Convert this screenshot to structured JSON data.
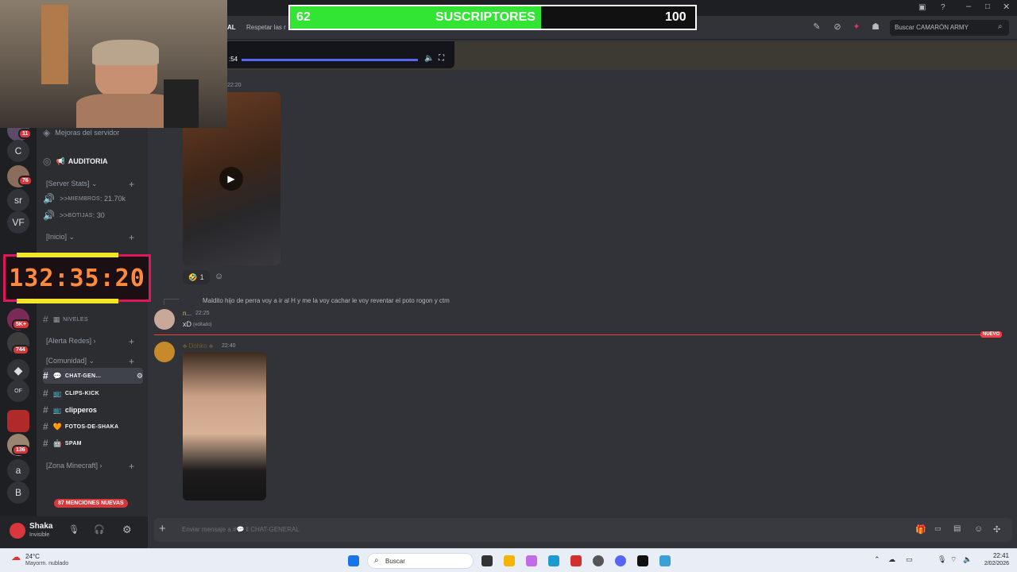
{
  "subscribers": {
    "current": "62",
    "label": "SUSCRIPTORES",
    "goal": "100",
    "progress": 0.62,
    "fill_color": "#33e533"
  },
  "timer": {
    "value": "132:35:20",
    "color": "#ff8a3d"
  },
  "topbar": {
    "channel_label": "AL",
    "topic": "Respetar las r",
    "search_placeholder": "Buscar CAMARÓN ARMY"
  },
  "video_player": {
    "time": ":54"
  },
  "rail": {
    "items": [
      {
        "label": "",
        "badge": "11"
      },
      {
        "label": "C",
        "badge": ""
      },
      {
        "label": "",
        "badge": "76"
      },
      {
        "label": "sr",
        "badge": ""
      },
      {
        "label": "VF",
        "badge": ""
      },
      {
        "label": "",
        "badge": "5K+"
      },
      {
        "label": "",
        "badge": "744"
      },
      {
        "label": "",
        "badge": ""
      },
      {
        "label": "OF",
        "badge": ""
      },
      {
        "label": "",
        "badge": ""
      },
      {
        "label": "",
        "badge": "136"
      },
      {
        "label": "a",
        "badge": ""
      },
      {
        "label": "B",
        "badge": ""
      }
    ]
  },
  "sidebar": {
    "boost": "Mejoras del servidor",
    "auditoria": "AUDITORIA",
    "server_stats": "[Server Stats]",
    "miembros_label": "MIEMBROS",
    "miembros_value": "21.70k",
    "botijas_label": "BOTIJAS",
    "botijas_value": "30",
    "inicio": "[Inicio]",
    "niveles": "NIVELES",
    "alerta_redes": "[Alerta Redes]",
    "comunidad": "[Comunidad]",
    "channels": [
      {
        "name": "CHAT-GEN...",
        "active": true
      },
      {
        "name": "CLIPS-KICK",
        "active": false
      },
      {
        "name": "clipperos",
        "active": false
      },
      {
        "name": "FOTOS-DE-SHAKA",
        "active": false
      },
      {
        "name": "SPAM",
        "active": false
      }
    ],
    "zona_minecraft": "[Zona Minecraft]",
    "menciones": "87 MENCIONES NUEVAS"
  },
  "user": {
    "name": "Shaka",
    "status": "Invisible"
  },
  "messages": {
    "ts1": "22:20",
    "reaction_count": "1",
    "reply_text": "Maldito hijo de perra voy a ir al H y me la voy cachar le voy reventar el poto rogon y ctm",
    "reply_author": "n...",
    "reply_ts": "22:25",
    "reply_body": "xD",
    "edited": "(editado)",
    "new_label": "NUEVO",
    "author3": "♣ Dohko ♣",
    "ts3": "22:40"
  },
  "composer": {
    "placeholder": "Enviar mensaje a #💬 ‖ CHAT-GENERAL"
  },
  "taskbar": {
    "weather_temp": "24°C",
    "weather_desc": "Mayorm. nublado",
    "search": "Buscar",
    "time": "22:41",
    "date": "2/02/2026"
  },
  "colors": {
    "accent_red": "#da373c",
    "timer_border": "#e0155b",
    "discord_bg": "#313338"
  }
}
